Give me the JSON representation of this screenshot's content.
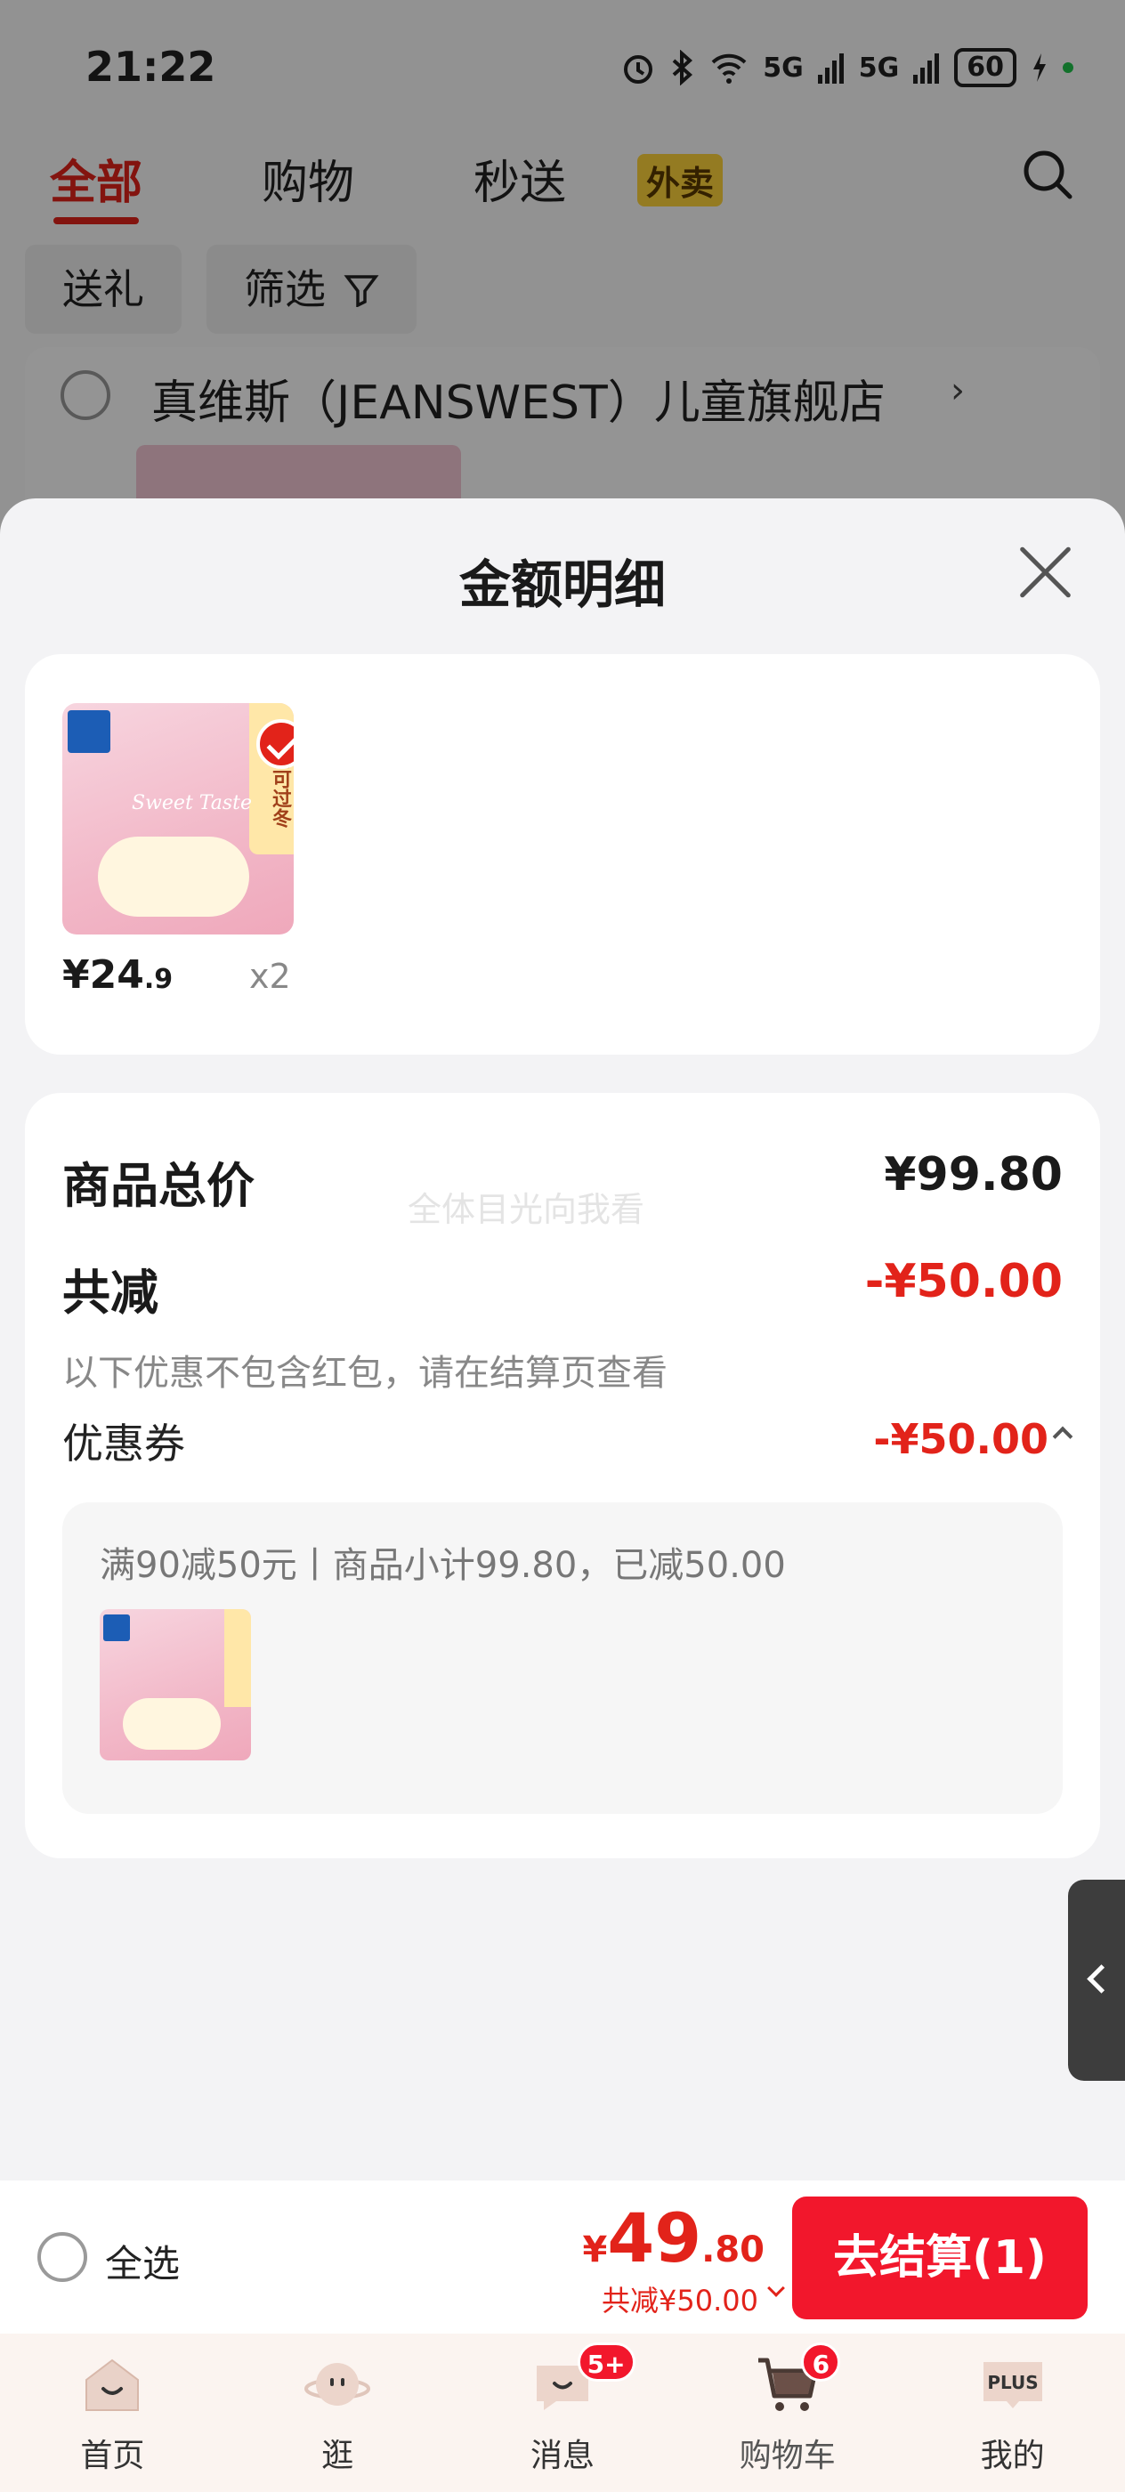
{
  "status_bar": {
    "time": "21:22",
    "network": "5G",
    "network2": "5G",
    "battery": "60"
  },
  "top_tabs": {
    "all": "全部",
    "shopping": "购物",
    "flash": "秒送",
    "flash_badge": "外卖"
  },
  "filters": {
    "gift": "送礼",
    "filter": "筛选"
  },
  "store": {
    "name": "真维斯（JEANSWEST）儿童旗舰店"
  },
  "sheet": {
    "title": "金额明细",
    "product": {
      "price_int": "¥24",
      "price_dec": ".9",
      "quantity": "x2",
      "image_text": "一条可过冬",
      "image_script": "Sweet Taste"
    },
    "summary": {
      "total_label": "商品总价",
      "total_value": "¥99.80",
      "discount_label": "共减",
      "discount_value": "-¥50.00",
      "note": "以下优惠不包含红包，请在结算页查看",
      "watermark": "全体目光向我看",
      "coupon_label": "优惠券",
      "coupon_value": "-¥50.00",
      "coupon_desc": "满90减50元丨商品小计99.80，已减50.00"
    }
  },
  "checkout": {
    "select_all": "全选",
    "total_currency": "¥",
    "total_int": "49",
    "total_dec": ".80",
    "saved": "共减¥50.00",
    "pay_button": "去结算(1)"
  },
  "tabbar": {
    "home": "首页",
    "browse": "逛",
    "messages": "消息",
    "messages_badge": "5+",
    "cart": "购物车",
    "cart_badge": "6",
    "mine": "我的",
    "mine_icon_text": "PLUS"
  },
  "colors": {
    "accent": "#e2231a",
    "pay_button": "#f2172c",
    "coupon_badge": "#ffd43b"
  }
}
